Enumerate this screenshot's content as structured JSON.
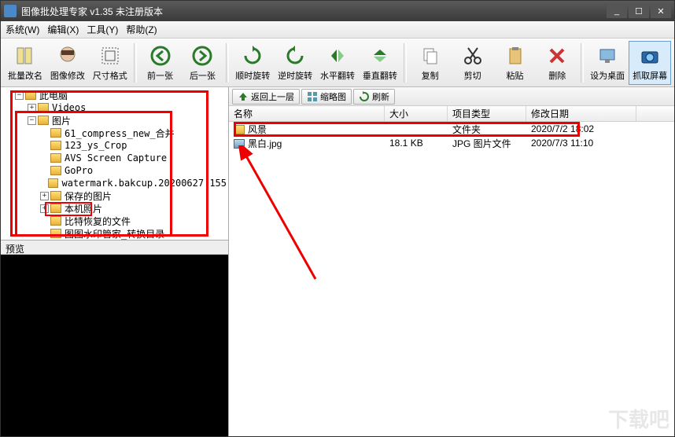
{
  "window": {
    "title": "图像批处理专家  v1.35 未注册版本"
  },
  "menu": {
    "system": "系统(W)",
    "edit": "编辑(X)",
    "tools": "工具(Y)",
    "help": "帮助(Z)"
  },
  "toolbar": {
    "rename": "批量改名",
    "modify": "图像修改",
    "size": "尺寸格式",
    "prev": "前一张",
    "next": "后一张",
    "rotcw": "顺时旋转",
    "rotccw": "逆时旋转",
    "fliph": "水平翻转",
    "flipv": "垂直翻转",
    "copy": "复制",
    "cut": "剪切",
    "paste": "粘贴",
    "delete": "删除",
    "desktop": "设为桌面",
    "capture": "抓取屏幕"
  },
  "tree": {
    "root": "此电脑",
    "videos": "Videos",
    "pictures": "图片",
    "items": [
      "61_compress_new_合并",
      "123_ys_Crop",
      "AVS Screen Capture",
      "GoPro",
      "watermark.bakcup.20200627.155",
      "保存的图片",
      "本机照片",
      "比特恢复的文件",
      "图图水印管家_转换目录"
    ]
  },
  "preview_label": "预览",
  "filebar": {
    "up": "返回上一层",
    "thumb": "缩略图",
    "refresh": "刷新"
  },
  "columns": {
    "name": "名称",
    "size": "大小",
    "type": "项目类型",
    "date": "修改日期"
  },
  "files": [
    {
      "name": "风景",
      "size": "",
      "type": "文件夹",
      "date": "2020/7/2 18:02",
      "kind": "folder"
    },
    {
      "name": "黑白.jpg",
      "size": "18.1 KB",
      "type": "JPG 图片文件",
      "date": "2020/7/3 11:10",
      "kind": "image"
    }
  ],
  "watermark": "下载吧"
}
